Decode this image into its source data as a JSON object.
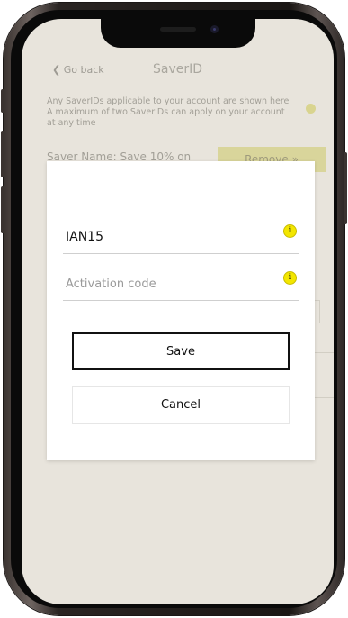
{
  "app": {
    "nav": {
      "back_label": "Go back",
      "title": "SaverID"
    },
    "info_text": "Any SaverIDs applicable to your account are shown here A maximum of two SaverIDs can apply on your account at any time",
    "saver_row": {
      "name_label": "Saver Name: Save 10% on",
      "remove_label": "Remove"
    }
  },
  "modal": {
    "fields": [
      {
        "value": "IAN15",
        "placeholder": "",
        "icon": "info-icon"
      },
      {
        "value": "",
        "placeholder": "Activation code",
        "icon": "info-icon"
      }
    ],
    "save_label": "Save",
    "cancel_label": "Cancel"
  },
  "colors": {
    "accent": "#f3e600",
    "screen_bg": "#ece9e0",
    "modal_bg": "#ffffff",
    "primary_border": "#111111"
  }
}
